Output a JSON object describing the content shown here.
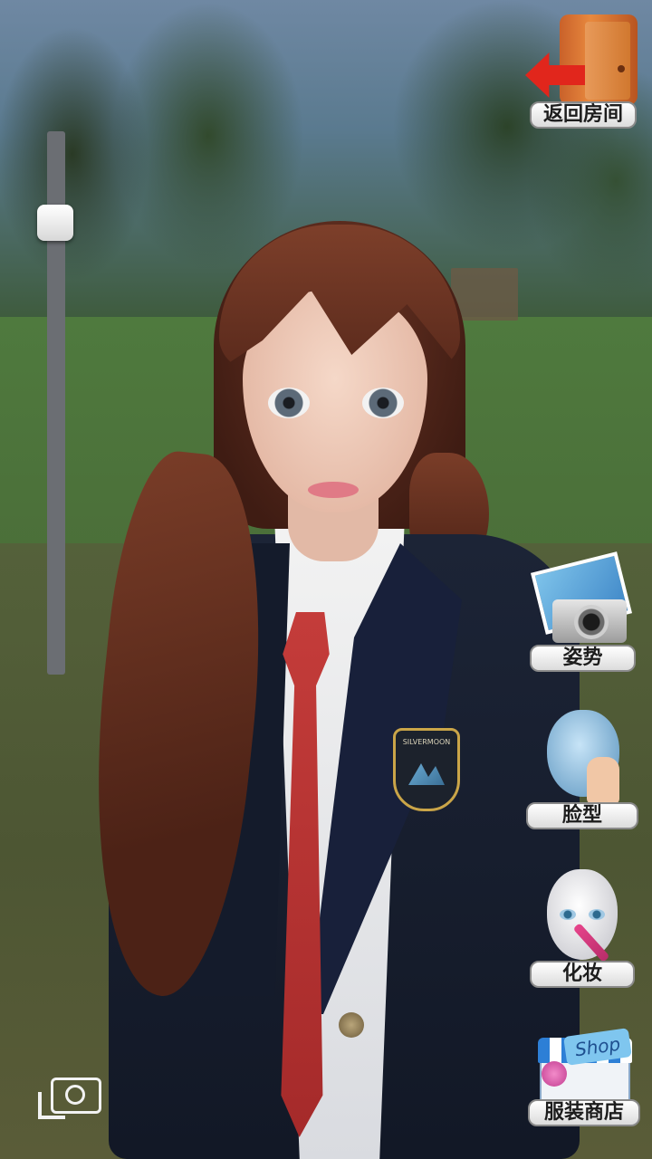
{
  "buttons": {
    "back_to_room": "返回房间",
    "pose": "姿势",
    "face_shape": "脸型",
    "makeup": "化妆",
    "clothing_shop": "服装商店"
  },
  "badge": {
    "text": "SILVERMOON"
  },
  "shop_sign": "Shop",
  "zoom_slider": {
    "value": 0.85
  }
}
